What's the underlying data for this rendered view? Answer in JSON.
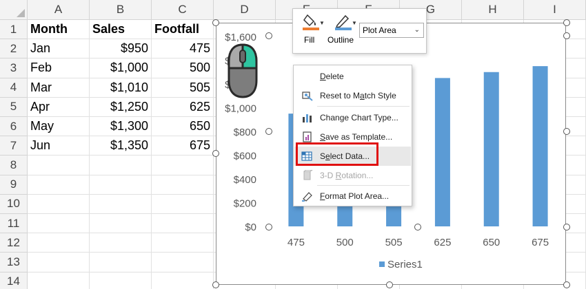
{
  "sheet": {
    "columns": [
      "A",
      "B",
      "C",
      "D",
      "E",
      "F",
      "G",
      "H",
      "I"
    ],
    "rows": [
      "1",
      "2",
      "3",
      "4",
      "5",
      "6",
      "7",
      "8",
      "9",
      "10",
      "11",
      "12",
      "13",
      "14"
    ],
    "cells": {
      "A1": "Month",
      "B1": "Sales",
      "C1": "Footfall",
      "A2": "Jan",
      "B2": "$950",
      "C2": "475",
      "A3": "Feb",
      "B3": "$1,000",
      "C3": "500",
      "A4": "Mar",
      "B4": "$1,010",
      "C4": "505",
      "A5": "Apr",
      "B5": "$1,250",
      "C5": "625",
      "A6": "May",
      "B6": "$1,300",
      "C6": "650",
      "A7": "Jun",
      "B7": "$1,350",
      "C7": "675"
    }
  },
  "chart_data": {
    "type": "bar",
    "categories": [
      "475",
      "500",
      "505",
      "625",
      "650",
      "675"
    ],
    "series": [
      {
        "name": "Series1",
        "values": [
          950,
          1000,
          1010,
          1250,
          1300,
          1350
        ]
      }
    ],
    "yticks": [
      "$0",
      "$200",
      "$400",
      "$600",
      "$800",
      "$1,000",
      "$1,200",
      "$1,400",
      "$1,600"
    ],
    "ylim": [
      0,
      1600
    ],
    "legend": "bottom",
    "bar_color": "#5b9bd5",
    "grid": false
  },
  "minibar": {
    "fill_label": "Fill",
    "outline_label": "Outline",
    "element_select": "Plot Area",
    "fill_color": "#ed7d31",
    "outline_color": "#5b9bd5"
  },
  "context_menu": {
    "items": [
      {
        "label": "Delete",
        "accel": "D",
        "icon": "none",
        "disabled": false
      },
      {
        "label": "Reset to Match Style",
        "accel": "a",
        "icon": "reset-style-icon",
        "disabled": false
      },
      {
        "label": "Change Chart Type...",
        "accel": "Y",
        "icon": "chart-type-icon",
        "disabled": false
      },
      {
        "label": "Save as Template...",
        "accel": "S",
        "icon": "template-icon",
        "disabled": false
      },
      {
        "label": "Select Data...",
        "accel": "e",
        "icon": "select-data-icon",
        "disabled": false
      },
      {
        "label": "3-D Rotation...",
        "accel": "R",
        "icon": "rotation-icon",
        "disabled": true
      },
      {
        "label": "Format Plot Area...",
        "accel": "F",
        "icon": "format-icon",
        "disabled": false
      }
    ],
    "highlighted": "Select Data...",
    "highlight_color": "#e01010"
  },
  "mouse": {
    "icon": "mouse-right-click-icon",
    "accent": "#2ec4a0"
  }
}
